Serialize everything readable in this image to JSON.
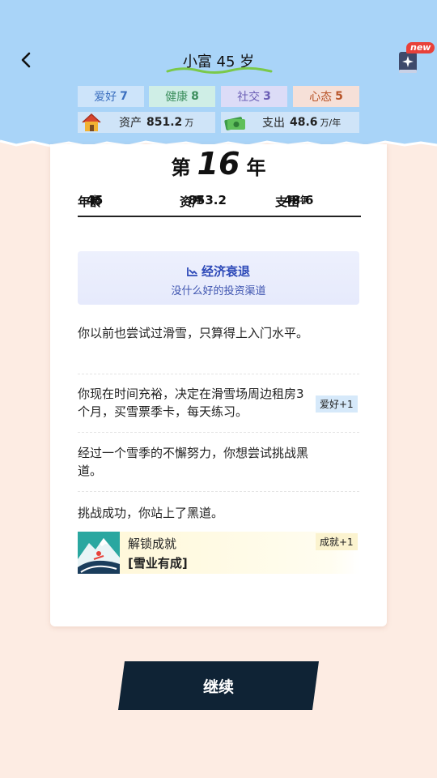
{
  "header": {
    "title": "小富 45 岁",
    "new_badge": "new",
    "stats": [
      {
        "label": "爱好",
        "value": "7"
      },
      {
        "label": "健康",
        "value": "8"
      },
      {
        "label": "社交",
        "value": "3"
      },
      {
        "label": "心态",
        "value": "5"
      }
    ],
    "assets": {
      "label": "资产",
      "value": "851.2",
      "unit": "万"
    },
    "expense": {
      "label": "支出",
      "value": "48.6",
      "unit": "万/年"
    }
  },
  "card": {
    "year_prefix": "第",
    "year_number": "16",
    "year_suffix": "年",
    "age_label": "年龄",
    "age_value": "45",
    "age_unit": "岁",
    "assets_label": "资产",
    "assets_value": "853.2",
    "assets_unit": "万",
    "expense_label": "支出",
    "expense_value": "48.6",
    "expense_unit": "万/年",
    "event": {
      "title": "经济衰退",
      "subtitle": "没什么好的投资渠道"
    },
    "story": [
      {
        "text": "你以前也尝试过滑雪，只算得上入门水平。"
      },
      {
        "text": "你现在时间充裕，决定在滑雪场周边租房3个月，买雪票季卡，每天练习。",
        "tag": "爱好+1"
      },
      {
        "text": "经过一个雪季的不懈努力，你想尝试挑战黑道。"
      },
      {
        "text": "挑战成功，你站上了黑道。"
      }
    ],
    "achievement": {
      "label": "解锁成就",
      "name": "[雪业有成]",
      "tag": "成就+1"
    }
  },
  "continue_label": "继续",
  "colors": {
    "header_bg": "#a9d4f8",
    "page_bg": "#fdece3",
    "button_bg": "#0f2335",
    "event_text": "#2d49b8"
  }
}
